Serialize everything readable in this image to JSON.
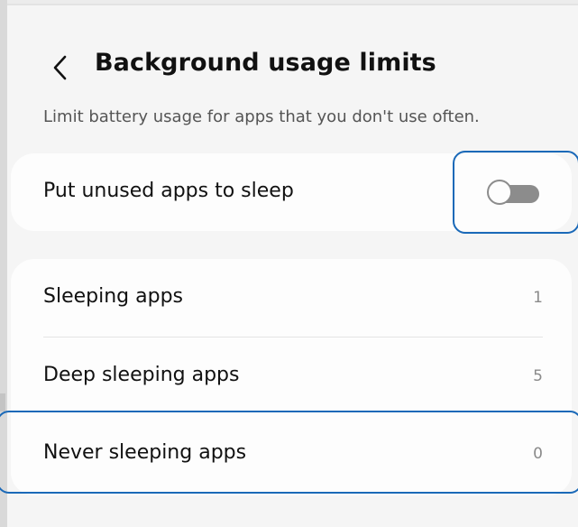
{
  "header": {
    "back_icon": "chevron-left-icon",
    "title": "Background usage limits"
  },
  "description": "Limit battery usage for apps that you don't use often.",
  "sleep_toggle": {
    "label": "Put unused apps to sleep",
    "state": "off"
  },
  "app_lists": [
    {
      "label": "Sleeping apps",
      "count": "1"
    },
    {
      "label": "Deep sleeping apps",
      "count": "5"
    },
    {
      "label": "Never sleeping apps",
      "count": "0"
    }
  ],
  "colors": {
    "highlight": "#1a69b8",
    "toggle_off": "#8c8c8c",
    "card_background": "#fdfdfd",
    "page_background": "#f5f5f5"
  }
}
